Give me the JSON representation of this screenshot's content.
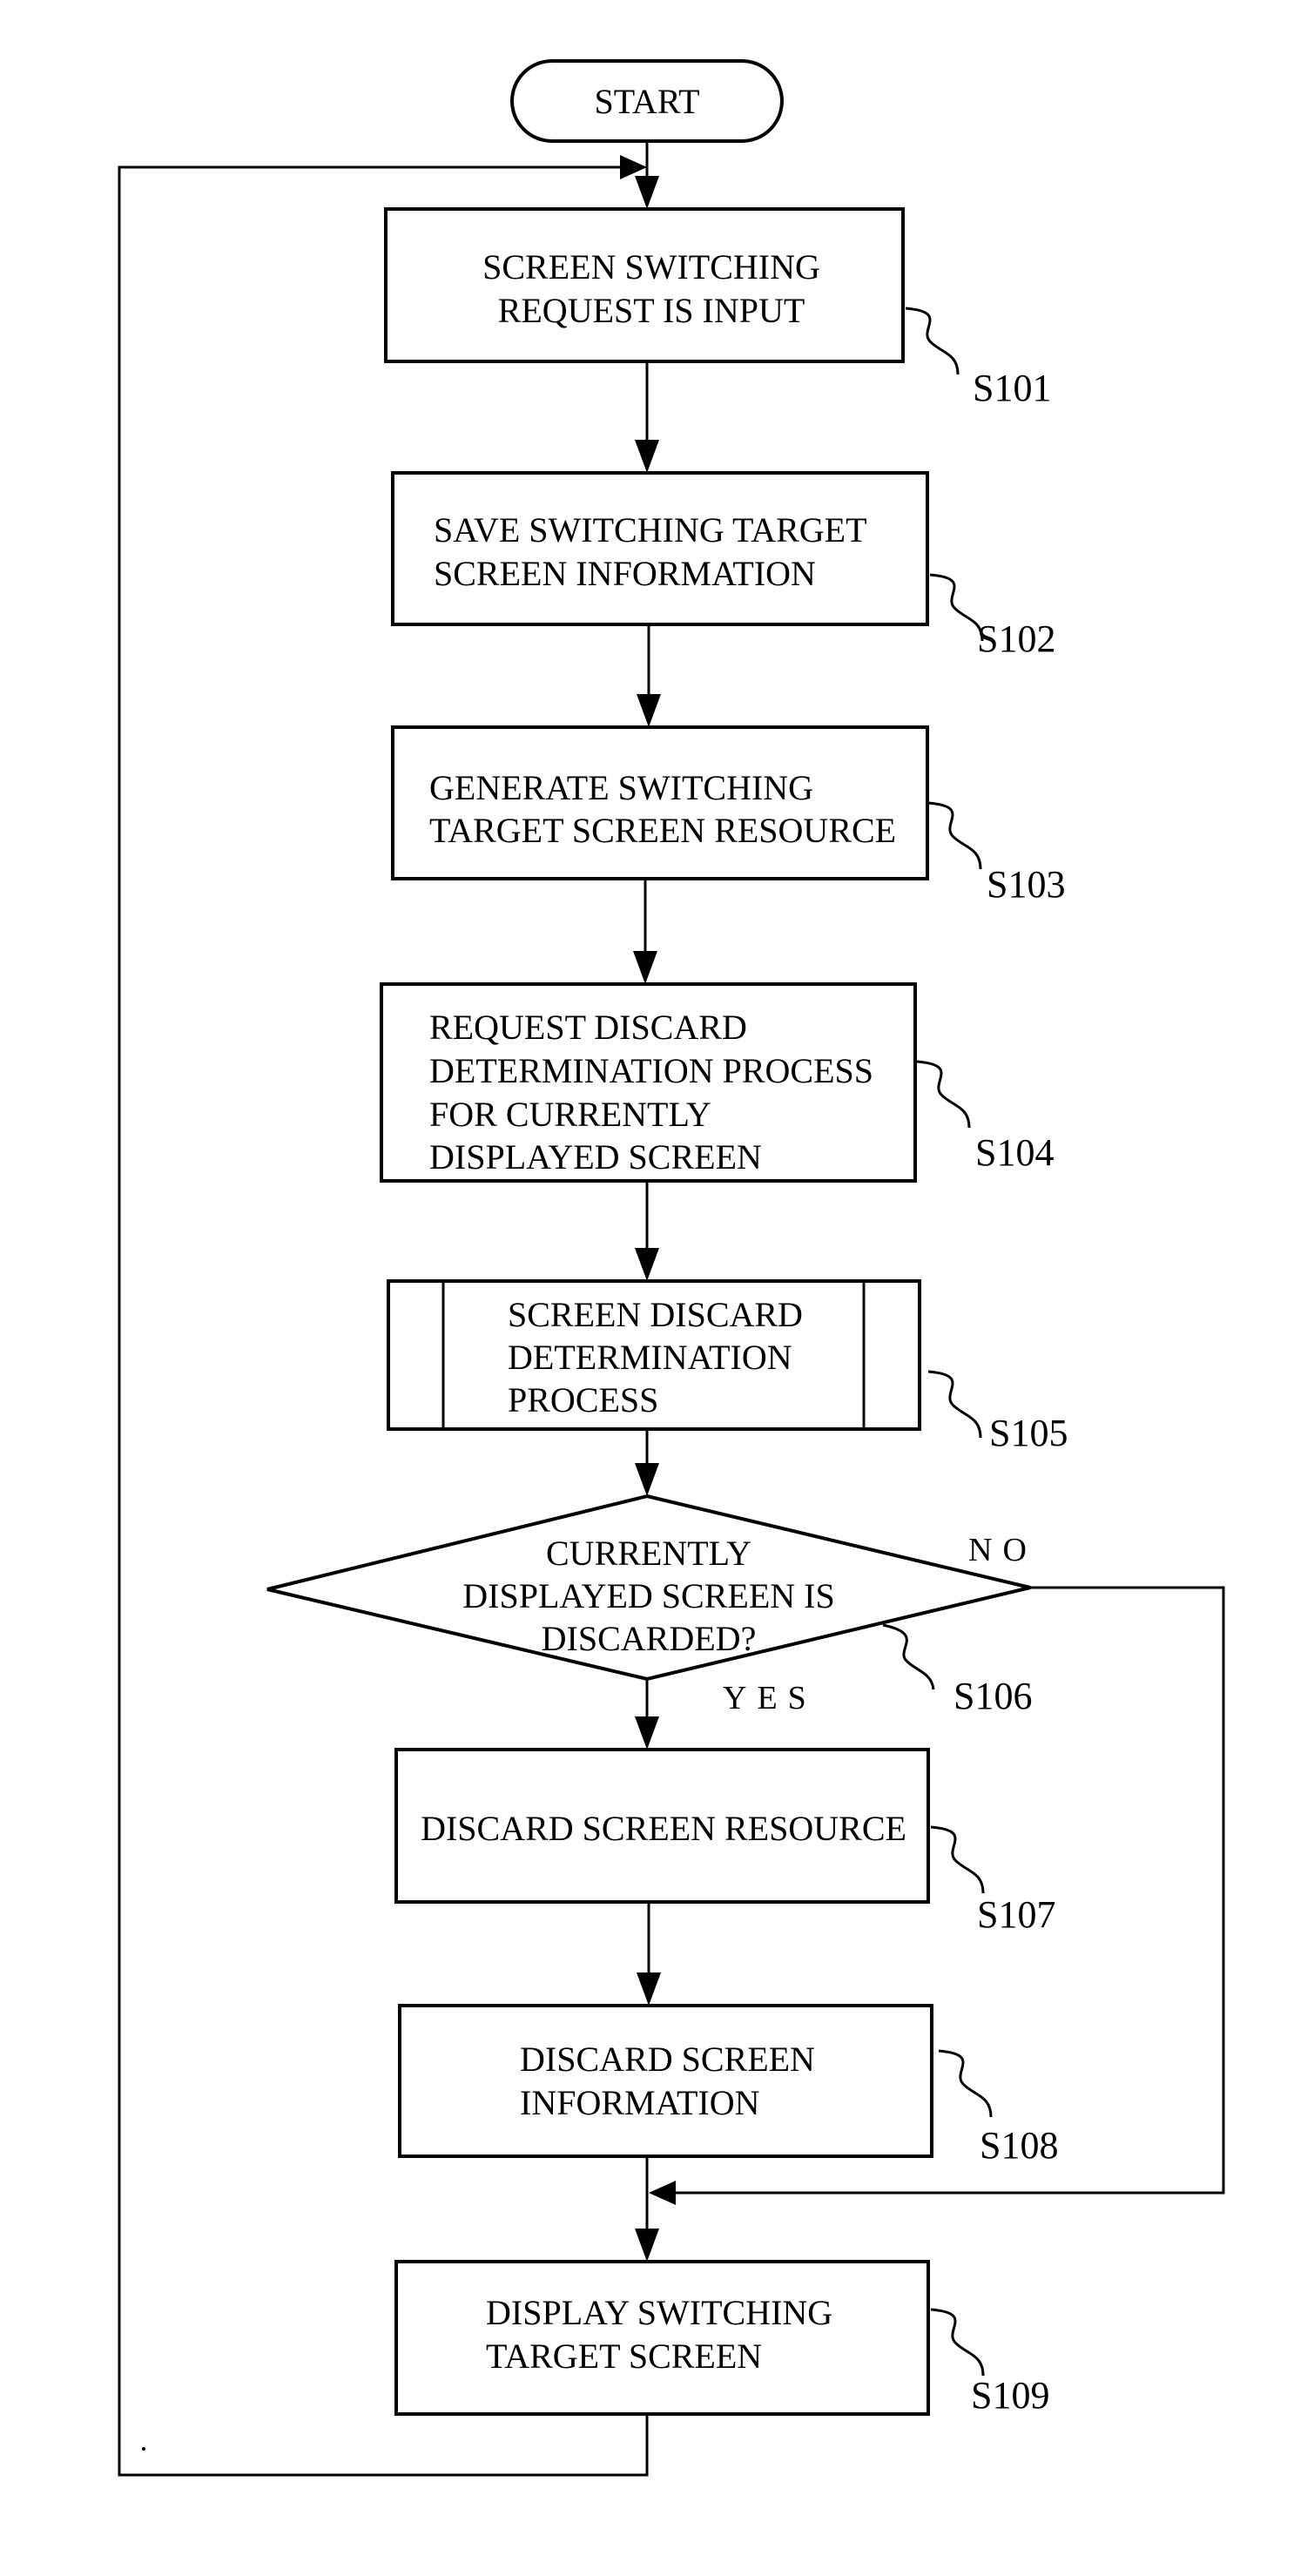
{
  "diagram": {
    "type": "flowchart",
    "start": {
      "label": "START"
    },
    "steps": [
      {
        "id": "S101",
        "lines": [
          "SCREEN SWITCHING",
          "REQUEST IS INPUT"
        ]
      },
      {
        "id": "S102",
        "lines": [
          "SAVE SWITCHING TARGET",
          "SCREEN INFORMATION"
        ]
      },
      {
        "id": "S103",
        "lines": [
          "GENERATE SWITCHING",
          "TARGET SCREEN RESOURCE"
        ]
      },
      {
        "id": "S104",
        "lines": [
          "REQUEST DISCARD",
          "DETERMINATION PROCESS",
          "FOR CURRENTLY",
          "DISPLAYED SCREEN"
        ]
      },
      {
        "id": "S105",
        "lines": [
          "SCREEN DISCARD",
          "DETERMINATION",
          "PROCESS"
        ],
        "kind": "predefined-process"
      },
      {
        "id": "S106",
        "lines": [
          "CURRENTLY",
          "DISPLAYED SCREEN IS",
          "DISCARDED?"
        ],
        "kind": "decision"
      },
      {
        "id": "S107",
        "lines": [
          "DISCARD SCREEN RESOURCE"
        ]
      },
      {
        "id": "S108",
        "lines": [
          "DISCARD SCREEN",
          "INFORMATION"
        ]
      },
      {
        "id": "S109",
        "lines": [
          "DISPLAY SWITCHING",
          "TARGET SCREEN"
        ]
      }
    ],
    "branches": {
      "yes": "YES",
      "no": "NO"
    }
  }
}
